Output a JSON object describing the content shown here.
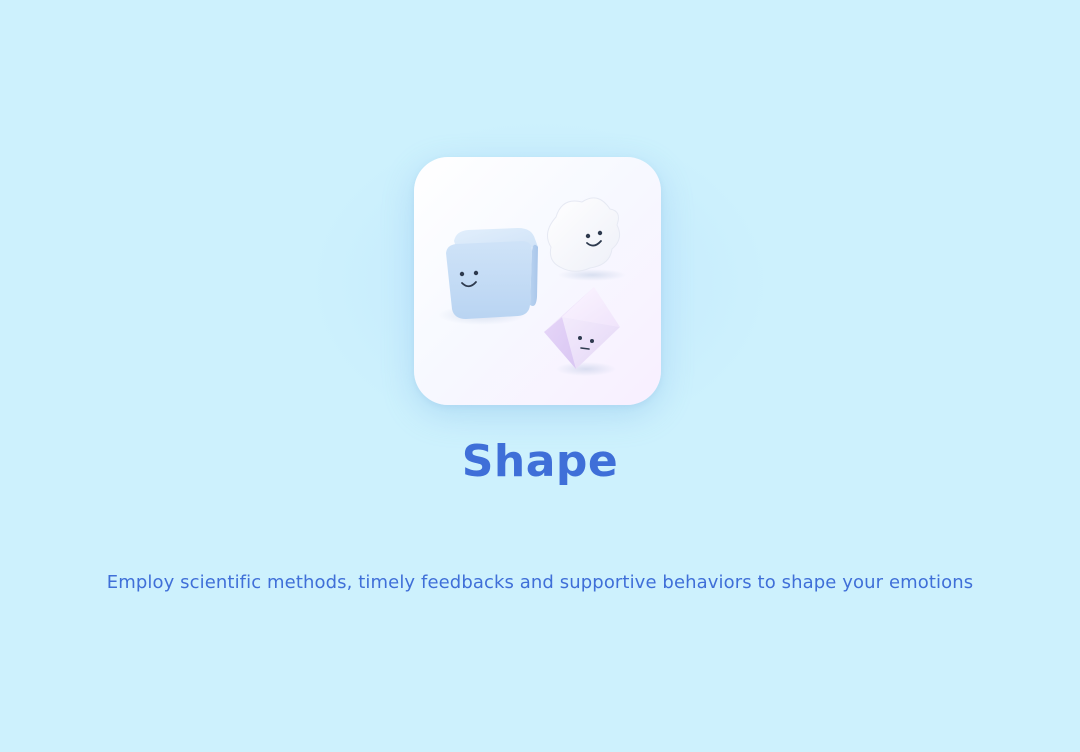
{
  "app": {
    "name": "Shape",
    "tagline": "Employ scientific methods, timely feedbacks and supportive behaviors to shape your emotions"
  },
  "icon": {
    "characters": [
      "cube-character-icon",
      "cloud-character-icon",
      "octahedron-character-icon"
    ]
  },
  "colors": {
    "background": "#cdf1fd",
    "accent": "#3f6fd8",
    "icon_tile": "#ffffff"
  }
}
